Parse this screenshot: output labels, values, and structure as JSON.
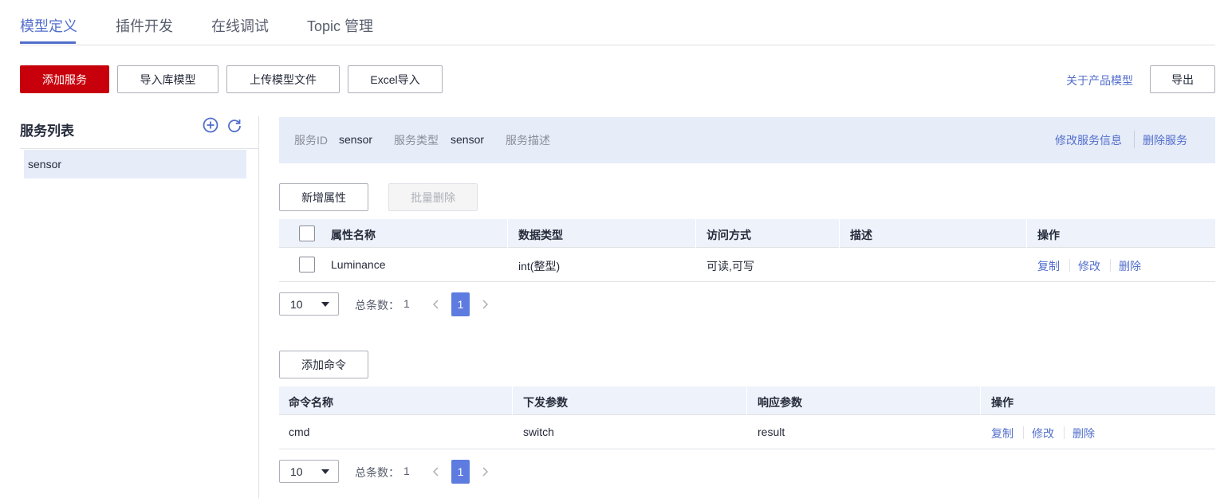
{
  "tabs": [
    {
      "label": "模型定义",
      "active": true
    },
    {
      "label": "插件开发",
      "active": false
    },
    {
      "label": "在线调试",
      "active": false
    },
    {
      "label": "Topic 管理",
      "active": false
    }
  ],
  "toolbar": {
    "add_service": "添加服务",
    "import_library": "导入库模型",
    "upload_model_file": "上传模型文件",
    "excel_import": "Excel导入",
    "about_product_model": "关于产品模型",
    "export": "导出"
  },
  "service_list": {
    "title": "服务列表",
    "add_icon": "plus-circle-icon",
    "refresh_icon": "refresh-icon",
    "items": [
      "sensor"
    ]
  },
  "service_info": {
    "id_label": "服务ID",
    "id_value": "sensor",
    "type_label": "服务类型",
    "type_value": "sensor",
    "desc_label": "服务描述",
    "desc_value": "",
    "edit_link": "修改服务信息",
    "delete_link": "删除服务"
  },
  "properties": {
    "add_button": "新增属性",
    "batch_delete_button": "批量删除",
    "columns": [
      "属性名称",
      "数据类型",
      "访问方式",
      "描述",
      "操作"
    ],
    "rows": [
      {
        "name": "Luminance",
        "data_type": "int(整型)",
        "access": "可读,可写",
        "description": "",
        "ops": [
          "复制",
          "修改",
          "删除"
        ]
      }
    ],
    "pagination": {
      "page_size": "10",
      "total_label": "总条数：",
      "total": "1",
      "current_page": "1"
    }
  },
  "commands": {
    "add_button": "添加命令",
    "columns": [
      "命令名称",
      "下发参数",
      "响应参数",
      "操作"
    ],
    "rows": [
      {
        "name": "cmd",
        "request": "switch",
        "response": "result",
        "ops": [
          "复制",
          "修改",
          "删除"
        ]
      }
    ],
    "pagination": {
      "page_size": "10",
      "total_label": "总条数：",
      "total": "1",
      "current_page": "1"
    }
  },
  "colors": {
    "primary_red": "#c7000b",
    "link_blue": "#526ecc",
    "page_active": "#5e7ce0",
    "info_bg": "#e6ecf8"
  }
}
